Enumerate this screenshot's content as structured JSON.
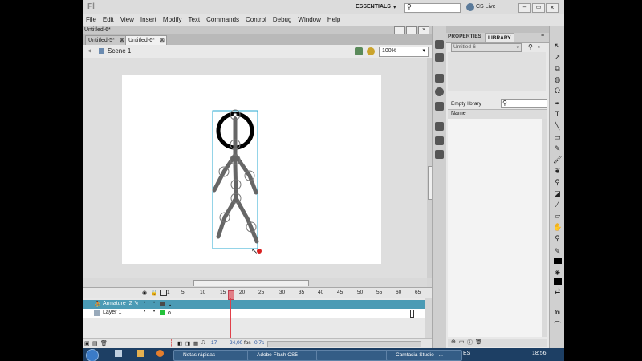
{
  "app": {
    "logo": "Fl",
    "workspace": "ESSENTIALS",
    "cs_live": "CS Live",
    "search_placeholder": ""
  },
  "menu": [
    "File",
    "Edit",
    "View",
    "Insert",
    "Modify",
    "Text",
    "Commands",
    "Control",
    "Debug",
    "Window",
    "Help"
  ],
  "document": {
    "title": "Untitled-6*",
    "tabs": [
      {
        "label": "Untitled-5*"
      },
      {
        "label": "Untitled-6*"
      }
    ],
    "scene": "Scene 1",
    "zoom": "100%"
  },
  "panel": {
    "tabs": [
      "PROPERTIES",
      "LIBRARY"
    ],
    "library_dropdown": "Untitled-6",
    "empty_text": "Empty library",
    "column_name": "Name"
  },
  "timeline": {
    "frame_numbers": [
      "1",
      "5",
      "10",
      "15",
      "20",
      "25",
      "30",
      "35",
      "40",
      "45",
      "50",
      "55",
      "60",
      "65"
    ],
    "layers": [
      {
        "name": "Armature_2"
      },
      {
        "name": "Layer 1"
      }
    ],
    "status": {
      "frame": "17",
      "fps": "24,00",
      "fps_unit": "fps",
      "time": "0,7s"
    }
  },
  "taskbar": {
    "items": [
      "Notas rápidas",
      "Adobe Flash CS5",
      "",
      "Camtasia Studio - ..."
    ],
    "language": "ES",
    "clock": "18:56"
  },
  "colors": {
    "armature_layer": "#4b9bb5",
    "selection_box": "#2aa8d0",
    "playhead": "#e0404a"
  }
}
